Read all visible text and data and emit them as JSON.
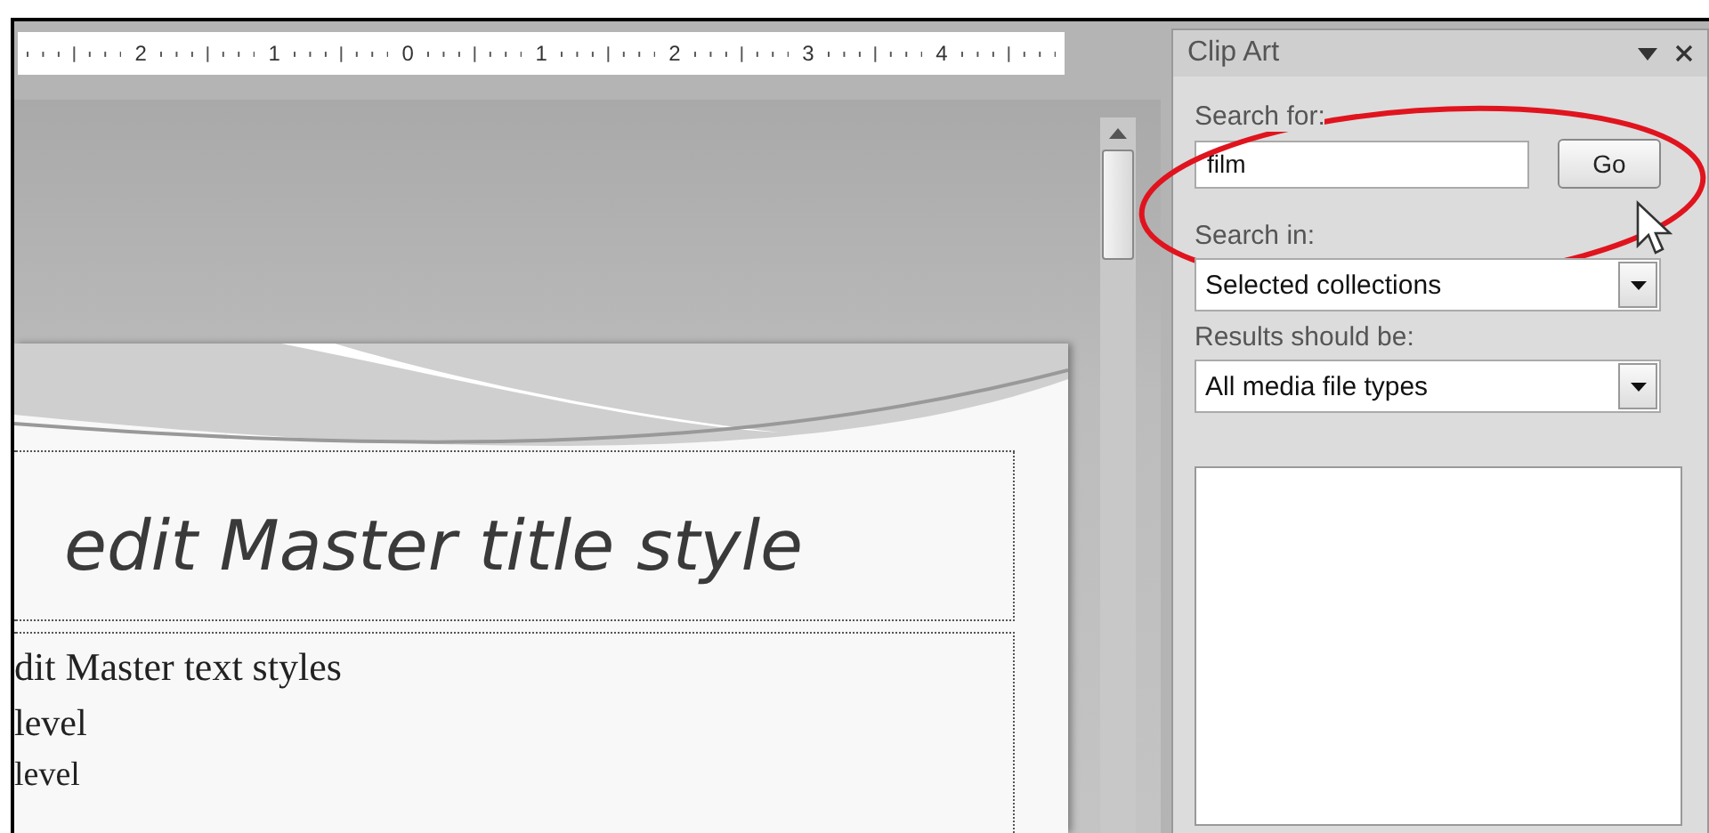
{
  "ruler": {
    "labels": [
      "2",
      "1",
      "0",
      "1",
      "2",
      "3",
      "4"
    ]
  },
  "slide": {
    "title": "edit Master title style",
    "body": [
      {
        "kind": "heading",
        "text": "dit Master text styles"
      },
      {
        "kind": "bullet",
        "text": "level"
      },
      {
        "kind": "sub-bullet",
        "text": "level"
      }
    ]
  },
  "pane": {
    "title": "Clip Art",
    "search_label": "Search for:",
    "search_value": "film",
    "go_button": "Go",
    "search_in_label": "Search in:",
    "search_in_value": "Selected collections",
    "results_label": "Results should be:",
    "results_value": "All media file types"
  }
}
